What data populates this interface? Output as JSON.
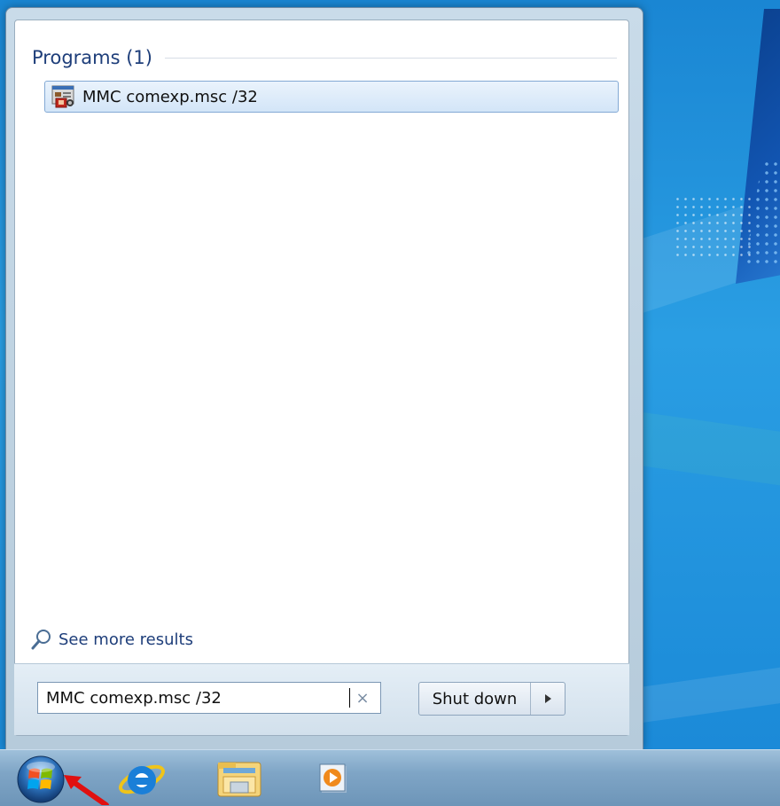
{
  "start_menu": {
    "section_title": "Programs (1)",
    "results": [
      {
        "label": "MMC comexp.msc /32",
        "icon": "mmc-console-icon"
      }
    ],
    "see_more": "See more results",
    "search": {
      "value": "MMC comexp.msc /32",
      "clear_glyph": "×"
    },
    "shutdown": {
      "label": "Shut down",
      "arrow_glyph": "▸"
    }
  },
  "taskbar": {
    "icons": [
      "windows-start-orb-icon",
      "internet-explorer-icon",
      "windows-explorer-icon",
      "media-player-icon"
    ]
  },
  "colors": {
    "desktop_blue": "#1e8fd6",
    "header_text": "#1e3e7a",
    "selection_border": "#83a9d4",
    "annotation_arrow": "#e01010"
  }
}
